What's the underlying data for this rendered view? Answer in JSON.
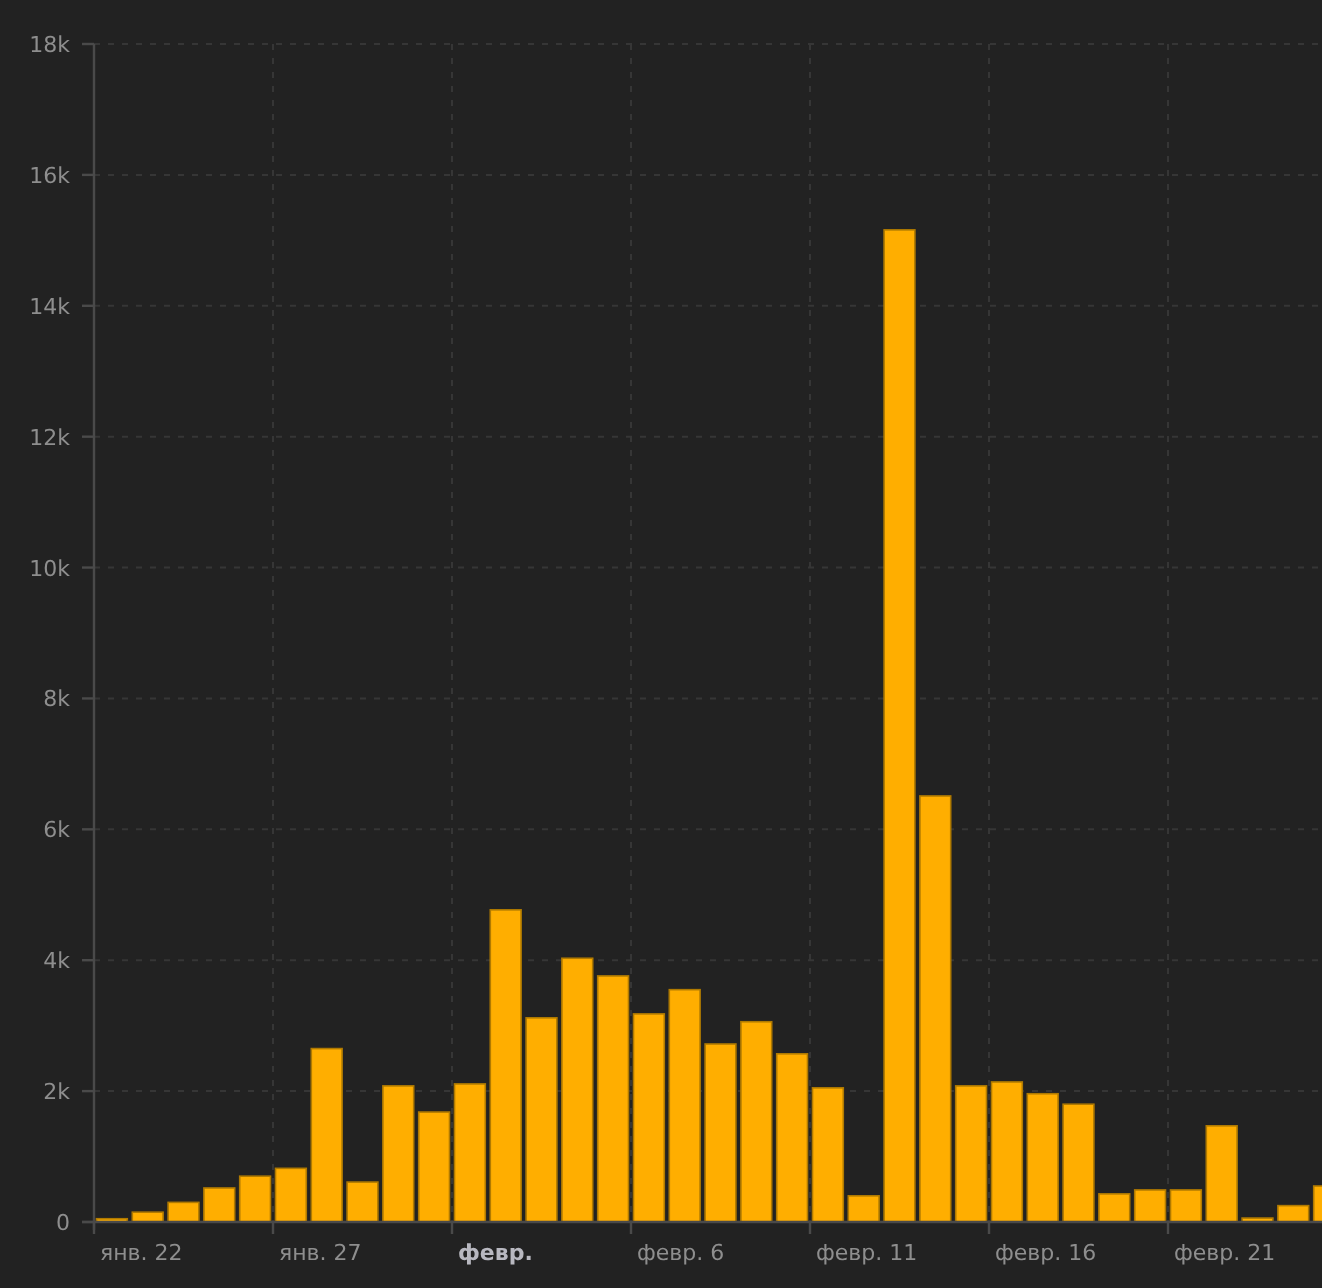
{
  "chart": {
    "chart_data": {
      "type": "bar",
      "categories": [
        null,
        "янв. 22",
        null,
        null,
        null,
        null,
        "янв. 27",
        null,
        null,
        null,
        null,
        "февр.",
        null,
        null,
        null,
        null,
        "февр. 6",
        null,
        null,
        null,
        null,
        "февр. 11",
        null,
        null,
        null,
        null,
        "февр. 16",
        null,
        null,
        null,
        null,
        "февр. 21",
        null,
        null,
        null
      ],
      "grid": true,
      "series": [
        {
          "color": "#ffae00",
          "values": [
            50,
            150,
            300,
            520,
            700,
            820,
            2650,
            610,
            2080,
            1680,
            2110,
            4770,
            3120,
            4030,
            3760,
            3180,
            3550,
            2720,
            3060,
            2570,
            2050,
            400,
            15160,
            6510,
            2080,
            2140,
            1960,
            1800,
            430,
            490,
            490,
            1470,
            60,
            250,
            550
          ]
        }
      ],
      "ylim": [
        0,
        18000
      ],
      "yticks": [
        {
          "value": 0,
          "label": "0"
        },
        {
          "value": 2000,
          "label": "2k"
        },
        {
          "value": 4000,
          "label": "4k"
        },
        {
          "value": 6000,
          "label": "6k"
        },
        {
          "value": 8000,
          "label": "8k"
        },
        {
          "value": 10000,
          "label": "10k"
        },
        {
          "value": 12000,
          "label": "12k"
        },
        {
          "value": 14000,
          "label": "14k"
        },
        {
          "value": 16000,
          "label": "16k"
        },
        {
          "value": 18000,
          "label": "18k"
        }
      ]
    },
    "x_labels_bold": [
      false,
      false,
      true,
      false,
      false,
      false,
      false
    ]
  }
}
